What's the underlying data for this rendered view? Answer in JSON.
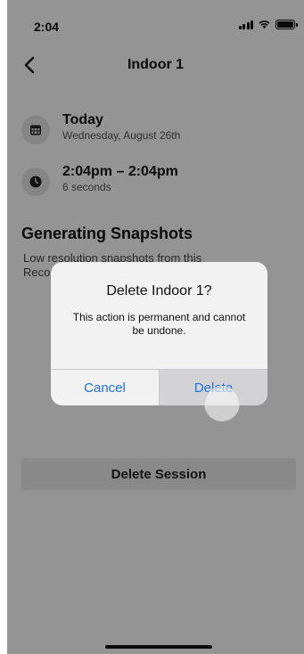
{
  "status_bar": {
    "time": "2:04"
  },
  "nav": {
    "title": "Indoor 1"
  },
  "date_info": {
    "title": "Today",
    "subtitle": "Wednesday, August 26th"
  },
  "time_info": {
    "title": "2:04pm – 2:04pm",
    "subtitle": "6 seconds"
  },
  "snapshots": {
    "title": "Generating Snapshots",
    "description": "Low resolution snapshots from this Recording..."
  },
  "delete_session_label": "Delete Session",
  "alert": {
    "title": "Delete Indoor 1?",
    "message": "This action is permanent and cannot be undone.",
    "cancel_label": "Cancel",
    "delete_label": "Delete"
  },
  "colors": {
    "accent": "#1a73e8",
    "overlay": "#000000"
  }
}
